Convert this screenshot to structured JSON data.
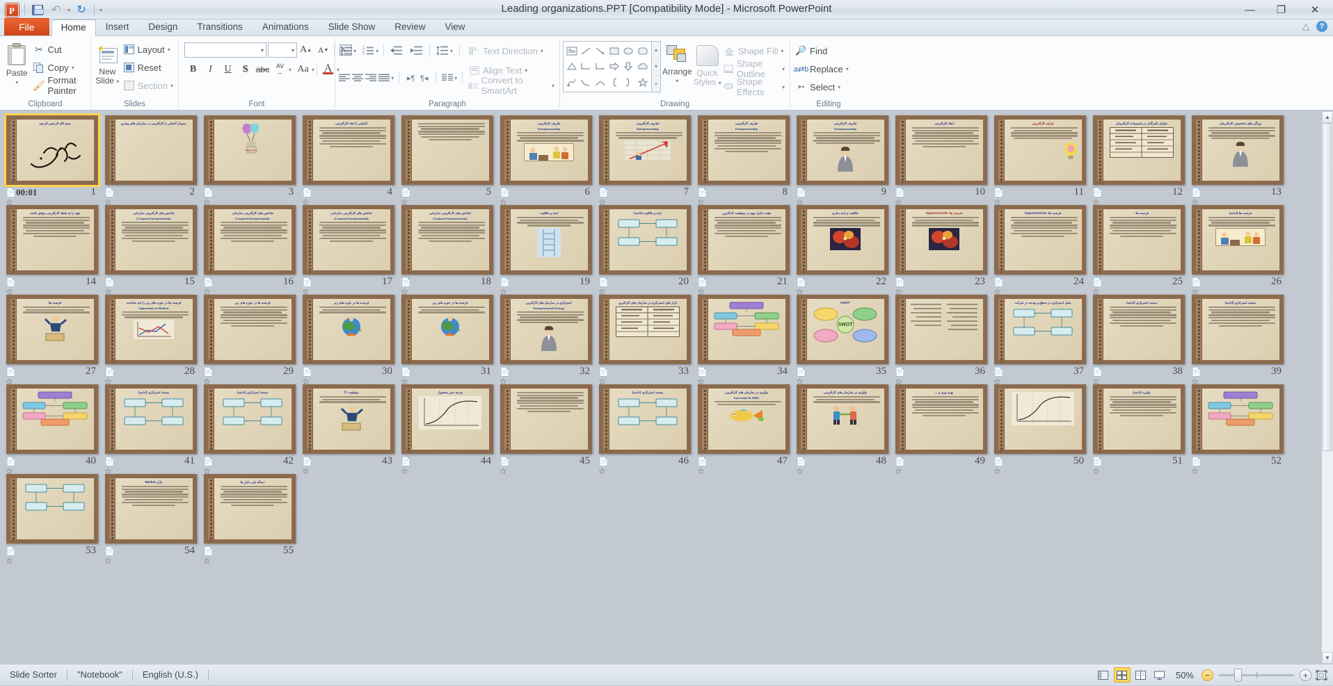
{
  "window": {
    "title": "Leading organizations.PPT [Compatibility Mode]  -  Microsoft PowerPoint",
    "minimize": "—",
    "restore": "❐",
    "close": "✕"
  },
  "quick_access": {
    "app_logo": "P",
    "save": "save-icon",
    "undo": "↶",
    "undo_caret": "▾",
    "redo": "↻",
    "customize_caret": "▾"
  },
  "tabs": [
    {
      "label": "File",
      "state": "file"
    },
    {
      "label": "Home",
      "state": "active"
    },
    {
      "label": "Insert",
      "state": ""
    },
    {
      "label": "Design",
      "state": ""
    },
    {
      "label": "Transitions",
      "state": ""
    },
    {
      "label": "Animations",
      "state": ""
    },
    {
      "label": "Slide Show",
      "state": ""
    },
    {
      "label": "Review",
      "state": ""
    },
    {
      "label": "View",
      "state": ""
    }
  ],
  "tabs_right": {
    "minimize_ribbon": "△",
    "help": "?"
  },
  "ribbon": {
    "clipboard": {
      "label": "Clipboard",
      "paste": "Paste",
      "paste_caret": "▾",
      "cut": "Cut",
      "copy": "Copy",
      "copy_caret": "▾",
      "format_painter": "Format Painter",
      "launcher": "↘"
    },
    "slides": {
      "label": "Slides",
      "new_slide_l1": "New",
      "new_slide_l2": "Slide",
      "new_slide_caret": "▾",
      "layout": "Layout",
      "layout_caret": "▾",
      "reset": "Reset",
      "section": "Section",
      "section_caret": "▾"
    },
    "font": {
      "label": "Font",
      "font_name_value": "",
      "font_size_value": "",
      "caret": "▾",
      "grow": "A",
      "shrink": "A",
      "clear_formatting": "A",
      "bold": "B",
      "italic": "I",
      "underline": "U",
      "shadow": "S",
      "strikethrough": "abc",
      "character_spacing": "AV",
      "change_case": "Aa",
      "font_color": "A",
      "launcher": "↘"
    },
    "paragraph": {
      "label": "Paragraph",
      "bullets": "bullets-icon",
      "numbering": "numbering-icon",
      "decrease_indent": "decrease-indent-icon",
      "increase_indent": "increase-indent-icon",
      "line_spacing": "line-spacing-icon",
      "align_left": "align-left-icon",
      "align_center": "align-center-icon",
      "align_right": "align-right-icon",
      "justify": "justify-icon",
      "ltr": "▸¶",
      "rtl": "¶◂",
      "columns": "columns-icon",
      "text_direction": "Text Direction",
      "align_text": "Align Text",
      "convert_smartart": "Convert to SmartArt",
      "caret": "▾",
      "launcher": "↘"
    },
    "drawing": {
      "label": "Drawing",
      "arrange": "Arrange",
      "arrange_caret": "▾",
      "quick_l1": "Quick",
      "quick_l2": "Styles",
      "quick_caret": "▾",
      "shape_fill": "Shape Fill",
      "shape_outline": "Shape Outline",
      "shape_effects": "Shape Effects",
      "caret": "▾",
      "launcher": "↘",
      "shapes": [
        "text-box-icon",
        "line-icon",
        "arrow-icon",
        "rectangle-icon",
        "oval-icon",
        "rounded-rectangle-icon",
        "triangle-icon",
        "elbow-connector-icon",
        "elbow-arrow-connector-icon",
        "right-arrow-icon",
        "down-arrow-icon",
        "cloud-icon",
        "freeform-icon",
        "curve-icon",
        "arc-icon",
        "left-brace-icon",
        "right-brace-icon",
        "star-icon"
      ],
      "scroll_up": "▴",
      "scroll_down": "▾",
      "scroll_more": "≡"
    },
    "editing": {
      "label": "Editing",
      "find": "Find",
      "replace": "Replace",
      "replace_caret": "▾",
      "select": "Select",
      "select_caret": "▾"
    }
  },
  "sorter": {
    "transition_icon": "transition-star-icon",
    "selected_slide_time": "00:01",
    "slides": [
      {
        "n": "1",
        "title": "بسم الله الرحمن الرحیم",
        "kind": "calligraphy",
        "selected": true
      },
      {
        "n": "2",
        "title": "سمینار آشنایی با کارآفرینی در سازمان های پیشرو",
        "kind": "title-only",
        "selected": false
      },
      {
        "n": "3",
        "title": "",
        "kind": "clipart-balloons",
        "selected": false
      },
      {
        "n": "4",
        "title": "آشنایی با ابعاد کارآفرینی",
        "kind": "text",
        "selected": false
      },
      {
        "n": "5",
        "title": "",
        "kind": "text-plain",
        "selected": false
      },
      {
        "n": "6",
        "title": "تعاریف کارآفرینی",
        "subtitle": "Entrepreneurship",
        "kind": "text-image",
        "selected": false
      },
      {
        "n": "7",
        "title": "تعاریف کارآفرینی",
        "subtitle": "Entrepreneurship",
        "kind": "text-chart",
        "selected": false
      },
      {
        "n": "8",
        "title": "تعاریف کارآفرینی",
        "subtitle": "Entrepreneurship",
        "kind": "text",
        "selected": false
      },
      {
        "n": "9",
        "title": "تعاریف کارآفرینی",
        "subtitle": "Entrepreneurship",
        "kind": "text-person",
        "selected": false
      },
      {
        "n": "10",
        "title": "ابعاد کارآفرینی",
        "kind": "text",
        "selected": false
      },
      {
        "n": "11",
        "title": "فرآیند کارآفرینی",
        "kind": "text-bulb",
        "selected": false
      },
      {
        "n": "12",
        "title": "عوامل تأثیرگذار در تصمیمات کارآفرینان",
        "kind": "table",
        "selected": false
      },
      {
        "n": "13",
        "title": "ویژگی های شخصیتی کارآفرینان",
        "kind": "text-person",
        "selected": false
      },
      {
        "n": "14",
        "title": "تهیه را به نقطه کارآفرینی موفق باشند",
        "kind": "text",
        "selected": false
      },
      {
        "n": "15",
        "title": "شاخص های کارآفرینی سازمانی",
        "subtitle": "(Carporal Entrepreneurial)",
        "kind": "text",
        "selected": false
      },
      {
        "n": "16",
        "title": "شاخص های کارآفرینی سازمانی",
        "subtitle": "(Carporal Entrepreneurial)",
        "kind": "text",
        "selected": false
      },
      {
        "n": "17",
        "title": "شاخص های کارآفرینی سازمانی",
        "subtitle": "(Carporal Entrepreneurial)",
        "kind": "text",
        "selected": false
      },
      {
        "n": "18",
        "title": "شاخص های کارآفرینی سازمانی",
        "subtitle": "(Carporal Entrepreneurial)",
        "kind": "text",
        "selected": false
      },
      {
        "n": "19",
        "title": "ایده و خلاقیت",
        "kind": "text-ladder",
        "selected": false
      },
      {
        "n": "20",
        "title": "ایده و خلاقیت (ادامه)",
        "kind": "diagram",
        "selected": false
      },
      {
        "n": "21",
        "title": "هفت عامل مهم در موفقیت کارآفرین",
        "kind": "text",
        "selected": false
      },
      {
        "n": "22",
        "title": "خلاقیت و ایده سازی",
        "kind": "text-photo",
        "selected": false
      },
      {
        "n": "23",
        "title": "فرصت ها: Opportunisite",
        "kind": "text-photo",
        "selected": false
      },
      {
        "n": "24",
        "title": "فرصت ها: Opportunisite",
        "kind": "text",
        "selected": false
      },
      {
        "n": "25",
        "title": "فرصت ها:",
        "kind": "text",
        "selected": false
      },
      {
        "n": "26",
        "title": "فرصت ها (ادامه)",
        "kind": "text-image",
        "selected": false
      },
      {
        "n": "27",
        "title": "فرصت ها",
        "kind": "text-jump",
        "selected": false
      },
      {
        "n": "28",
        "title": "فرصت ها در حوزه های زیر را باید شناخت",
        "subtitle": "Opportunity in Markets",
        "kind": "text-graph",
        "selected": false
      },
      {
        "n": "29",
        "title": "فرصت ها در حوزه های زیر",
        "kind": "text",
        "selected": false
      },
      {
        "n": "30",
        "title": "فرصت ها در حوزه های زیر",
        "kind": "text-globe",
        "selected": false
      },
      {
        "n": "31",
        "title": "فرصت ها در حوزه های زیر",
        "kind": "text-globe",
        "selected": false
      },
      {
        "n": "32",
        "title": "استراتژی در سازمان های کارآفرین",
        "subtitle": "Entrepreneurial Strategy",
        "kind": "text-person",
        "selected": false
      },
      {
        "n": "33",
        "title": "ابزار های استراتژی در سازمان های کارآفرین",
        "kind": "table",
        "selected": false
      },
      {
        "n": "34",
        "title": "",
        "kind": "diagram-color",
        "selected": false
      },
      {
        "n": "35",
        "title": "SWOT",
        "kind": "swot",
        "selected": false
      },
      {
        "n": "36",
        "title": "",
        "kind": "text-two-col",
        "selected": false
      },
      {
        "n": "37",
        "title": "محل استراتژی در سطح و بودجه در شرکت",
        "kind": "diagram",
        "selected": false
      },
      {
        "n": "38",
        "title": "مبحث استراتژی (ادامه)",
        "kind": "text",
        "selected": false
      },
      {
        "n": "39",
        "title": "مبحث استراتژی (ادامه)",
        "kind": "text",
        "selected": false
      },
      {
        "n": "40",
        "title": "",
        "kind": "diagram-color",
        "selected": false
      },
      {
        "n": "41",
        "title": "مبحث استراتژی (ادامه)",
        "kind": "diagram",
        "selected": false
      },
      {
        "n": "42",
        "title": "مبحث استراتژی (ادامه)",
        "kind": "diagram",
        "selected": false
      },
      {
        "n": "43",
        "title": "موفقیت ؟؟",
        "kind": "text-jump",
        "selected": false
      },
      {
        "n": "44",
        "title": "چرخه عمر محصول",
        "kind": "curve-chart",
        "selected": false
      },
      {
        "n": "45",
        "title": "",
        "kind": "text",
        "selected": false
      },
      {
        "n": "46",
        "title": "مبحث استراتژی (ادامه)",
        "kind": "diagram",
        "selected": false
      },
      {
        "n": "47",
        "title": "نوآوری در سازمان های کارآفرینی",
        "subtitle": "Inovvasion In SMEs",
        "kind": "clipart-fish",
        "selected": false
      },
      {
        "n": "48",
        "title": "نوآوری در سازمان های کارآفرینی",
        "kind": "clipart-people",
        "selected": false
      },
      {
        "n": "49",
        "title": "بهره وری و ...",
        "kind": "text",
        "selected": false
      },
      {
        "n": "50",
        "title": "",
        "kind": "curve-chart",
        "selected": false
      },
      {
        "n": "51",
        "title": "نوآورد (ادامه)",
        "kind": "text",
        "selected": false
      },
      {
        "n": "52",
        "title": "",
        "kind": "diagram-color",
        "selected": false
      },
      {
        "n": "53",
        "title": "",
        "kind": "diagram",
        "selected": false
      },
      {
        "n": "54",
        "title": "بازار Market",
        "kind": "text",
        "selected": false
      },
      {
        "n": "55",
        "title": "دمباله یابی بازار ها",
        "kind": "text",
        "selected": false
      }
    ]
  },
  "statusbar": {
    "view_name": "Slide Sorter",
    "theme_name": "\"Notebook\"",
    "language": "English (U.S.)",
    "views": [
      {
        "name": "normal-view-button",
        "active": false
      },
      {
        "name": "slide-sorter-view-button",
        "active": true
      },
      {
        "name": "reading-view-button",
        "active": false
      },
      {
        "name": "slide-show-button",
        "active": false
      }
    ],
    "zoom_level": "50%",
    "zoom_out": "−",
    "zoom_in": "+",
    "fit_to_window": "fit-slide-to-window-icon"
  }
}
